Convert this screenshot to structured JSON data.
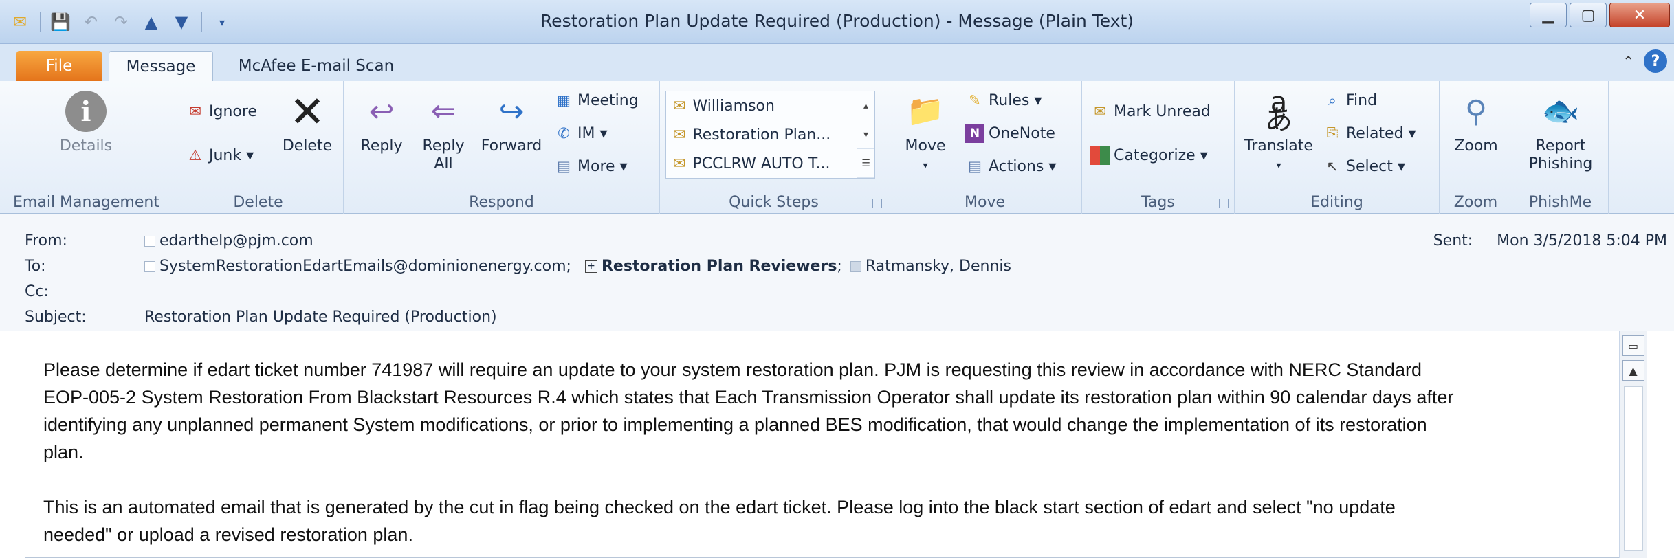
{
  "window": {
    "title": "Restoration Plan Update Required (Production)  -  Message (Plain Text)"
  },
  "tabs": {
    "file": "File",
    "message": "Message",
    "mcafee": "McAfee E-mail Scan"
  },
  "ribbon": {
    "email_management": {
      "group": "Email Management",
      "details": "Details"
    },
    "delete": {
      "group": "Delete",
      "ignore": "Ignore",
      "junk": "Junk ▾",
      "delete": "Delete"
    },
    "respond": {
      "group": "Respond",
      "reply": "Reply",
      "reply_all_1": "Reply",
      "reply_all_2": "All",
      "forward": "Forward",
      "meeting": "Meeting",
      "im": "IM ▾",
      "more": "More ▾"
    },
    "quick_steps": {
      "group": "Quick Steps",
      "items": [
        "Williamson",
        "Restoration Plan...",
        "PCCLRW AUTO T..."
      ]
    },
    "move": {
      "group": "Move",
      "move": "Move",
      "rules": "Rules ▾",
      "onenote": "OneNote",
      "actions": "Actions ▾"
    },
    "tags": {
      "group": "Tags",
      "mark_unread": "Mark Unread",
      "categorize": "Categorize ▾"
    },
    "editing": {
      "group": "Editing",
      "translate": "Translate",
      "find": "Find",
      "related": "Related ▾",
      "select": "Select ▾"
    },
    "zoom": {
      "group": "Zoom",
      "zoom": "Zoom"
    },
    "phishme": {
      "group": "PhishMe",
      "report_1": "Report",
      "report_2": "Phishing"
    }
  },
  "header": {
    "from_label": "From:",
    "from_value": "edarthelp@pjm.com",
    "to_label": "To:",
    "to_1": "SystemRestorationEdartEmails@dominionenergy.com;",
    "to_2": "Restoration Plan Reviewers",
    "to_2_sep": ";",
    "to_3": "Ratmansky, Dennis",
    "cc_label": "Cc:",
    "subject_label": "Subject:",
    "subject_value": "Restoration Plan Update Required (Production)",
    "sent_label": "Sent:",
    "sent_value": "Mon 3/5/2018 5:04 PM"
  },
  "body": {
    "p1_l1": "Please determine if edart ticket number 741987 will require an update to your system restoration plan. PJM is requesting this review in accordance with NERC Standard",
    "p1_l2": "EOP-005-2 System Restoration From Blackstart Resources R.4 which states that Each Transmission Operator shall update its restoration plan within 90 calendar days after",
    "p1_l3": "identifying any unplanned permanent System modifications, or prior to implementing a planned BES modification, that would change the implementation of its restoration",
    "p1_l4": "plan.",
    "p2_l1": "This is an automated email that is generated by the cut in flag being checked on the edart ticket. Please log into the black start section of edart and select \"no update",
    "p2_l2": "needed\" or upload a revised restoration plan."
  },
  "icons": [
    "mail-icon",
    "save-icon",
    "undo-icon",
    "redo-icon",
    "up-arrow-icon",
    "down-arrow-icon",
    "info-icon",
    "ignore-icon",
    "junk-icon",
    "delete-x-icon",
    "reply-icon",
    "reply-all-icon",
    "forward-icon",
    "meeting-icon",
    "im-icon",
    "more-icon",
    "move-icon",
    "rules-icon",
    "onenote-icon",
    "actions-icon",
    "mark-unread-icon",
    "categorize-icon",
    "translate-icon",
    "find-icon",
    "related-icon",
    "select-icon",
    "zoom-icon",
    "phishing-fish-icon"
  ],
  "colors": {
    "file_tab": "#e4741b",
    "accent": "#2f72c8"
  }
}
